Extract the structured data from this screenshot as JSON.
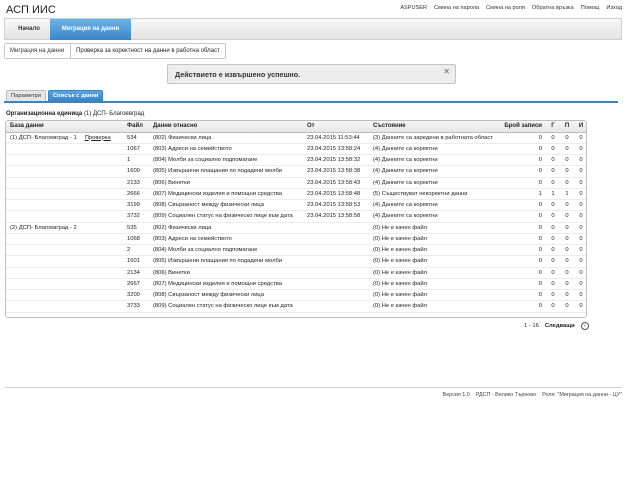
{
  "app": {
    "title": "АСП ИИС"
  },
  "top_links": [
    "ASPUSER",
    "Смяна на парола",
    "Смяна на роля",
    "Обратна връзка",
    "Помощ",
    "Изход"
  ],
  "nav": {
    "home": "Начало",
    "migration": "Миграция на данни"
  },
  "breadcrumb": {
    "parent": "Миграция на данни",
    "current": "Проверка за коректност на данни в работна област"
  },
  "notice": {
    "text": "Действието е извършено успешно.",
    "close": "✕"
  },
  "subtabs": {
    "params": "Параметри",
    "files": "Списък с данни"
  },
  "org": {
    "label": "Организационна единица",
    "value": "(1) ДСП- Благоевград"
  },
  "table": {
    "headers": [
      "База данни",
      "Файл",
      "Данни отнасно",
      "От",
      "Състояние",
      "Брой записи",
      "Г",
      "П",
      "И"
    ],
    "rows": [
      {
        "db": "(1) ДСП- Благоевград - 1",
        "link": "Проверка",
        "file": "534",
        "about": "(802) Физически лица",
        "from": "23.04.2015 11:53:44",
        "state": "(3) Данните са заредени в работната област",
        "count": "0",
        "g": "0",
        "p": "0",
        "i": "0"
      },
      {
        "db": "",
        "link": "",
        "file": "1067",
        "about": "(803) Адреси на семейството",
        "from": "23.04.2015 13:58:24",
        "state": "(4) Данните са коректни",
        "count": "0",
        "g": "0",
        "p": "0",
        "i": "0"
      },
      {
        "db": "",
        "link": "",
        "file": "1",
        "about": "(804) Молби за социално подпомагане",
        "from": "23.04.2015 13:58:32",
        "state": "(4) Данните са коректни",
        "count": "0",
        "g": "0",
        "p": "0",
        "i": "0"
      },
      {
        "db": "",
        "link": "",
        "file": "1600",
        "about": "(805) Извършени плащания по подадени молби",
        "from": "23.04.2015 13:58:38",
        "state": "(4) Данните са коректни",
        "count": "0",
        "g": "0",
        "p": "0",
        "i": "0"
      },
      {
        "db": "",
        "link": "",
        "file": "2133",
        "about": "(806) Винетки",
        "from": "23.04.2015 13:58:43",
        "state": "(4) Данните са коректни",
        "count": "0",
        "g": "0",
        "p": "0",
        "i": "0"
      },
      {
        "db": "",
        "link": "",
        "file": "2666",
        "about": "(807) Медицински изделия и помощни средства",
        "from": "23.04.2015 13:58:48",
        "state": "(5) Съществуват некоректни данни",
        "count": "1",
        "g": "1",
        "p": "1",
        "i": "0"
      },
      {
        "db": "",
        "link": "",
        "file": "3199",
        "about": "(808) Свързаност между физически лица",
        "from": "23.04.2015 13:58:53",
        "state": "(4) Данните са коректни",
        "count": "0",
        "g": "0",
        "p": "0",
        "i": "0"
      },
      {
        "db": "",
        "link": "",
        "file": "3732",
        "about": "(809) Социален статус на физическо лице към дата",
        "from": "23.04.2015 13:58:58",
        "state": "(4) Данните са коректни",
        "count": "0",
        "g": "0",
        "p": "0",
        "i": "0"
      },
      {
        "db": "(2) ДСП- Благоевград - 2",
        "link": "",
        "file": "535",
        "about": "(802) Физически лица",
        "from": "",
        "state": "(0) Не е качен файл",
        "count": "0",
        "g": "0",
        "p": "0",
        "i": "0"
      },
      {
        "db": "",
        "link": "",
        "file": "1068",
        "about": "(803) Адреси на семейството",
        "from": "",
        "state": "(0) Не е качен файл",
        "count": "0",
        "g": "0",
        "p": "0",
        "i": "0"
      },
      {
        "db": "",
        "link": "",
        "file": "2",
        "about": "(804) Молби за социално подпомагане",
        "from": "",
        "state": "(0) Не е качен файл",
        "count": "0",
        "g": "0",
        "p": "0",
        "i": "0"
      },
      {
        "db": "",
        "link": "",
        "file": "1601",
        "about": "(805) Извършени плащания по подадени молби",
        "from": "",
        "state": "(0) Не е качен файл",
        "count": "0",
        "g": "0",
        "p": "0",
        "i": "0"
      },
      {
        "db": "",
        "link": "",
        "file": "2134",
        "about": "(806) Винетки",
        "from": "",
        "state": "(0) Не е качен файл",
        "count": "0",
        "g": "0",
        "p": "0",
        "i": "0"
      },
      {
        "db": "",
        "link": "",
        "file": "2667",
        "about": "(807) Медицински изделия и помощни средства",
        "from": "",
        "state": "(0) Не е качен файл",
        "count": "0",
        "g": "0",
        "p": "0",
        "i": "0"
      },
      {
        "db": "",
        "link": "",
        "file": "3200",
        "about": "(808) Свързаност между физически лица",
        "from": "",
        "state": "(0) Не е качен файл",
        "count": "0",
        "g": "0",
        "p": "0",
        "i": "0"
      },
      {
        "db": "",
        "link": "",
        "file": "3733",
        "about": "(809) Социален статус на физическо лице към дата",
        "from": "",
        "state": "(0) Не е качен файл",
        "count": "0",
        "g": "0",
        "p": "0",
        "i": "0"
      }
    ]
  },
  "pager": {
    "range": "1 - 16",
    "next": "Следващи",
    "next_icon": "›"
  },
  "footer": [
    "Версия 1.0",
    "РДСП - Велико Търново",
    "Роля: \"Миграция на данни - ЦУ\""
  ],
  "colors": {
    "accent": "#3a84c4",
    "nav_active": "#4a95d2"
  }
}
